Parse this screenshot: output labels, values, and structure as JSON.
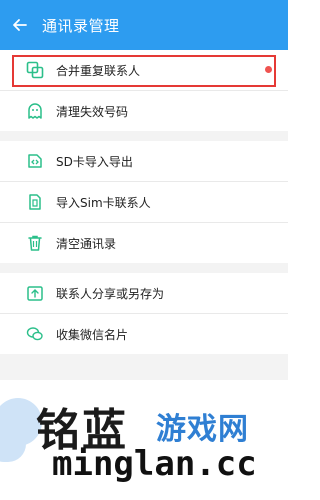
{
  "header": {
    "title": "通讯录管理",
    "back_icon": "arrow-left-icon"
  },
  "colors": {
    "header_bg": "#2d9cf0",
    "icon_green": "#2bbf8a",
    "highlight": "#e53935",
    "badge": "#ef5350"
  },
  "menu": {
    "merge": {
      "label": "合并重复联系人",
      "icon": "merge-icon"
    },
    "clean_invalid": {
      "label": "清理失效号码",
      "icon": "ghost-icon"
    },
    "sd_import_export": {
      "label": "SD卡导入导出",
      "icon": "sd-card-icon"
    },
    "import_sim": {
      "label": "导入Sim卡联系人",
      "icon": "sim-card-icon"
    },
    "clear_contacts": {
      "label": "清空通讯录",
      "icon": "trash-icon"
    },
    "share_save": {
      "label": "联系人分享或另存为",
      "icon": "share-icon"
    },
    "collect_wechat": {
      "label": "收集微信名片",
      "icon": "wechat-icon"
    }
  },
  "watermark": {
    "brand_cn_1": "铭蓝",
    "brand_cn_2": "游戏网",
    "url": "minglan.cc"
  }
}
